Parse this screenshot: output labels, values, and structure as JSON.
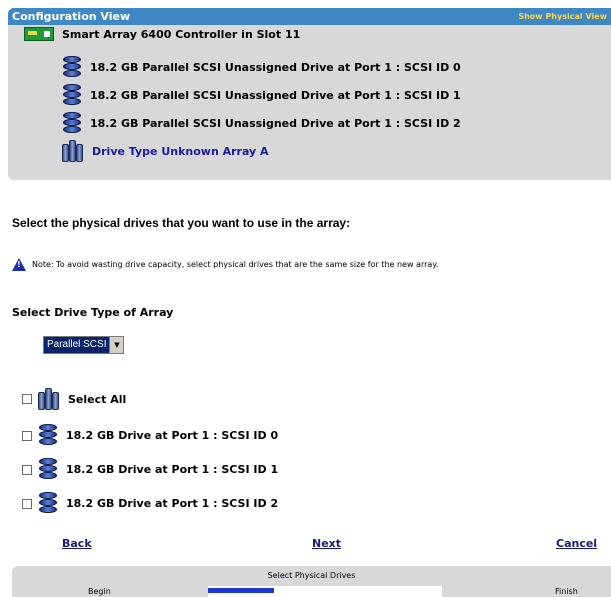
{
  "config_view": {
    "title": "Configuration View",
    "show_physical_label": "Show Physical View",
    "controller_label": "Smart Array 6400 Controller in Slot 11",
    "unassigned_drives": [
      "18.2 GB Parallel SCSI Unassigned Drive at Port 1 : SCSI ID 0",
      "18.2 GB Parallel SCSI Unassigned Drive at Port 1 : SCSI ID 1",
      "18.2 GB Parallel SCSI Unassigned Drive at Port 1 : SCSI ID 2"
    ],
    "array_label": "Drive Type Unknown Array A"
  },
  "main": {
    "prompt": "Select the physical drives that you want to use in the array:",
    "note": "Note: To avoid wasting drive capacity, select physical drives that are the same size for the new array.",
    "drive_type_label": "Select Drive Type of Array",
    "drive_type_selected": "Parallel SCSI",
    "select_all_label": "Select All",
    "drives": [
      "18.2 GB Drive at Port 1 : SCSI ID 0",
      "18.2 GB Drive at Port 1 : SCSI ID 1",
      "18.2 GB Drive at Port 1 : SCSI ID 2"
    ]
  },
  "navigation": {
    "back_label": "Back",
    "next_label": "Next",
    "cancel_label": "Cancel"
  },
  "wizard_progress": {
    "step_title": "Select Physical Drives",
    "begin_label": "Begin",
    "finish_label": "Finish",
    "progress_percent": 28
  },
  "colors": {
    "header_blue": "#3f88c6",
    "show_physical_yellow": "#ffd44a",
    "panel_gray": "#d8d8d8",
    "progress_blue": "#1c3ad0"
  }
}
